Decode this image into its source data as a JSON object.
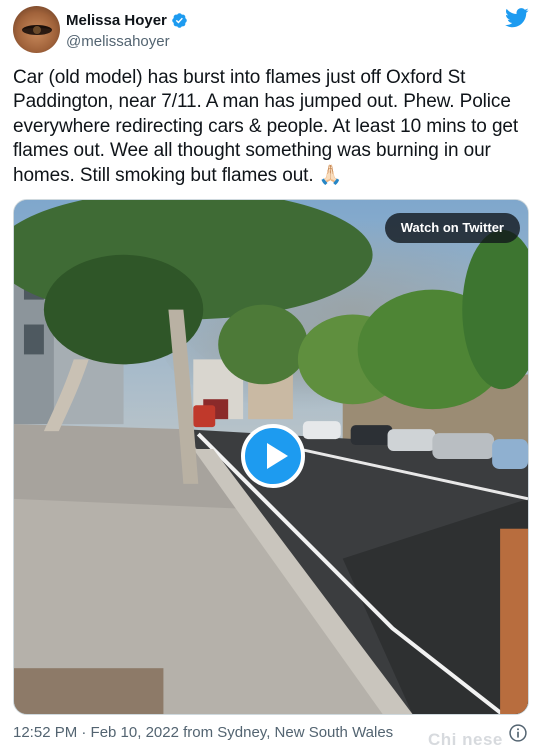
{
  "author": {
    "name": "Melissa Hoyer",
    "handle": "@melissahoyer",
    "verified": true
  },
  "tweet": {
    "text": "Car (old model) has burst into flames just off Oxford St Paddington, near 7/11. A man has jumped out. Phew. Police everywhere redirecting cars & people. At least 10 mins to get flames out. Wee all thought  something was burning in our homes. Still smoking but flames out. 🙏🏻"
  },
  "media": {
    "watch_label": "Watch on Twitter",
    "type": "video"
  },
  "footer": {
    "meta": "12:52 PM · Feb 10, 2022 from Sydney, New South Wales"
  },
  "watermark": "Chi nese",
  "colors": {
    "twitter_blue": "#1d9bf0",
    "text_primary": "#0f1419",
    "text_secondary": "#536471"
  },
  "icons": [
    "verified-badge-icon",
    "twitter-bird-icon",
    "play-icon",
    "info-icon"
  ]
}
